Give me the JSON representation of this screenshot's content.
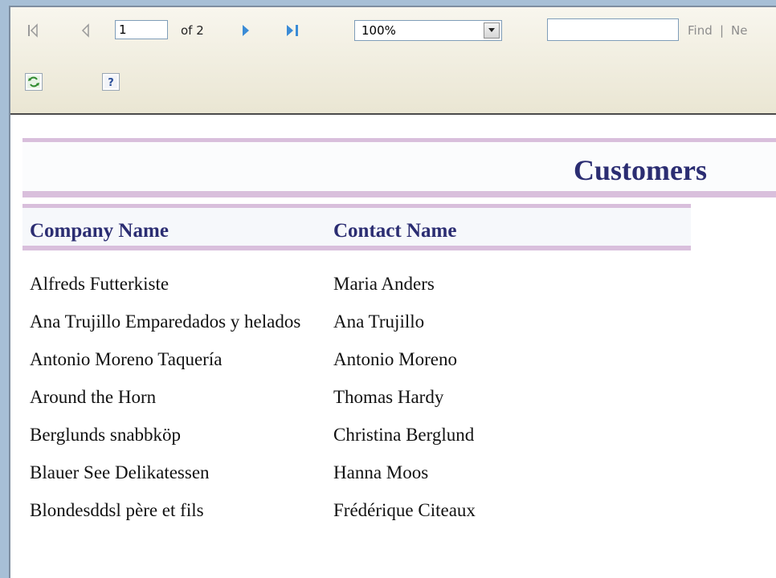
{
  "toolbar": {
    "page_number": "1",
    "of_pages": "of 2",
    "zoom": "100%",
    "find_placeholder": "",
    "find_label": "Find",
    "separator": "|",
    "next_label": "Ne",
    "icons": [
      "first-page-icon",
      "previous-page-icon",
      "next-page-icon",
      "last-page-icon",
      "dropdown-arrow-icon",
      "refresh-icon",
      "help-icon"
    ]
  },
  "report": {
    "title": "Customers",
    "columns": {
      "company": "Company Name",
      "contact": "Contact Name"
    },
    "rows": [
      {
        "company": "Alfreds Futterkiste",
        "contact": "Maria Anders"
      },
      {
        "company": "Ana Trujillo Emparedados y helados",
        "contact": "Ana Trujillo"
      },
      {
        "company": "Antonio Moreno Taquería",
        "contact": "Antonio Moreno"
      },
      {
        "company": "Around the Horn",
        "contact": "Thomas Hardy"
      },
      {
        "company": "Berglunds snabbköp",
        "contact": "Christina Berglund"
      },
      {
        "company": "Blauer See Delikatessen",
        "contact": "Hanna Moos"
      },
      {
        "company": "Blondesddsl père et fils",
        "contact": "Frédérique Citeaux"
      }
    ]
  },
  "colors": {
    "title": "#2b2d72",
    "band": "#d9bfdc",
    "frame": "#a7bfd6"
  }
}
